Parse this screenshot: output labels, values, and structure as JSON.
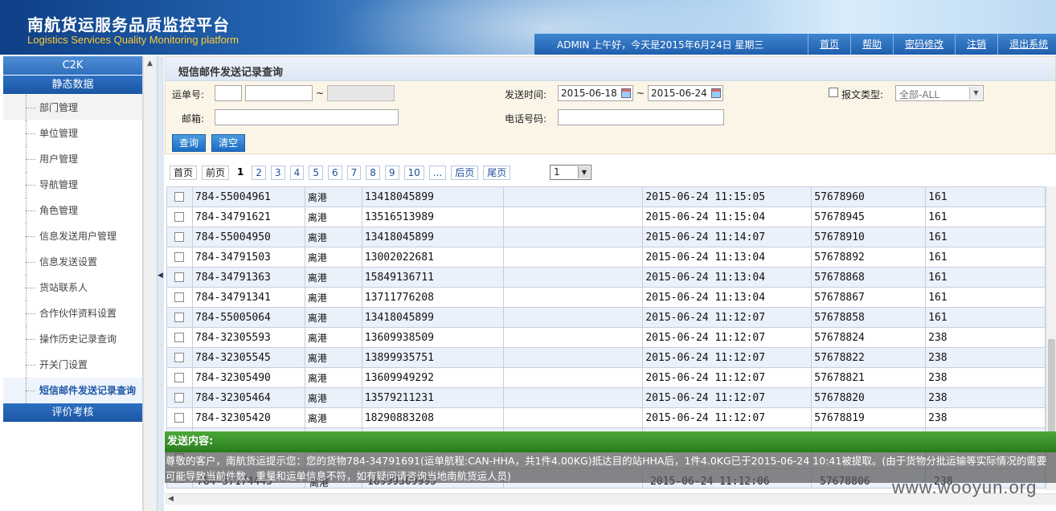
{
  "header": {
    "title_cn": "南航货运服务品质监控平台",
    "title_en": "Logistics Services Quality Monitoring platform",
    "greeting": "ADMIN 上午好，今天是2015年6月24日 星期三",
    "links": [
      "首页",
      "帮助",
      "密码修改",
      "注销",
      "退出系统"
    ]
  },
  "sidebar": {
    "section_c2k": "C2K",
    "section_static": "静态数据",
    "items": [
      "部门管理",
      "单位管理",
      "用户管理",
      "导航管理",
      "角色管理",
      "信息发送用户管理",
      "信息发送设置",
      "货站联系人",
      "合作伙伴资料设置",
      "操作历史记录查询",
      "开关门设置",
      "短信邮件发送记录查询"
    ],
    "section_eval": "评价考核"
  },
  "search": {
    "title": "短信邮件发送记录查询",
    "waybill_label": "运单号:",
    "tilde": "~",
    "send_time_label": "发送时间:",
    "date_from": "2015-06-18",
    "date_to": "2015-06-24",
    "msg_type_label": "报文类型:",
    "msg_type_value": "全部-ALL",
    "email_label": "邮箱:",
    "phone_label": "电话号码:",
    "query_button": "查询",
    "clear_button": "清空"
  },
  "pager": {
    "first": "首页",
    "prev": "前页",
    "current": "1",
    "pages": [
      "2",
      "3",
      "4",
      "5",
      "6",
      "7",
      "8",
      "9",
      "10"
    ],
    "ellipsis": "...",
    "next": "后页",
    "last": "尾页",
    "select_value": "1"
  },
  "table": {
    "rows": [
      {
        "waybill": "784-55004961",
        "type": "离港",
        "phone": "13418045899",
        "email": "",
        "time": "2015-06-24 11:15:05",
        "id": "57678960",
        "code": "161"
      },
      {
        "waybill": "784-34791621",
        "type": "离港",
        "phone": "13516513989",
        "email": "",
        "time": "2015-06-24 11:15:04",
        "id": "57678945",
        "code": "161"
      },
      {
        "waybill": "784-55004950",
        "type": "离港",
        "phone": "13418045899",
        "email": "",
        "time": "2015-06-24 11:14:07",
        "id": "57678910",
        "code": "161"
      },
      {
        "waybill": "784-34791503",
        "type": "离港",
        "phone": "13002022681",
        "email": "",
        "time": "2015-06-24 11:13:04",
        "id": "57678892",
        "code": "161"
      },
      {
        "waybill": "784-34791363",
        "type": "离港",
        "phone": "15849136711",
        "email": "",
        "time": "2015-06-24 11:13:04",
        "id": "57678868",
        "code": "161"
      },
      {
        "waybill": "784-34791341",
        "type": "离港",
        "phone": "13711776208",
        "email": "",
        "time": "2015-06-24 11:13:04",
        "id": "57678867",
        "code": "161"
      },
      {
        "waybill": "784-55005064",
        "type": "离港",
        "phone": "13418045899",
        "email": "",
        "time": "2015-06-24 11:12:07",
        "id": "57678858",
        "code": "161"
      },
      {
        "waybill": "784-32305593",
        "type": "离港",
        "phone": "13609938509",
        "email": "",
        "time": "2015-06-24 11:12:07",
        "id": "57678824",
        "code": "238"
      },
      {
        "waybill": "784-32305545",
        "type": "离港",
        "phone": "13899935751",
        "email": "",
        "time": "2015-06-24 11:12:07",
        "id": "57678822",
        "code": "238"
      },
      {
        "waybill": "784-32305490",
        "type": "离港",
        "phone": "13609949292",
        "email": "",
        "time": "2015-06-24 11:12:07",
        "id": "57678821",
        "code": "238"
      },
      {
        "waybill": "784-32305464",
        "type": "离港",
        "phone": "13579211231",
        "email": "",
        "time": "2015-06-24 11:12:07",
        "id": "57678820",
        "code": "238"
      },
      {
        "waybill": "784-32305420",
        "type": "离港",
        "phone": "18290883208",
        "email": "",
        "time": "2015-06-24 11:12:07",
        "id": "57678819",
        "code": "238"
      },
      {
        "waybill": "",
        "type": "",
        "phone": "",
        "email": "",
        "time": "",
        "id": "",
        "code": ""
      },
      {
        "waybill": "",
        "type": "",
        "phone": "",
        "email": "",
        "time": "",
        "id": "",
        "code": ""
      },
      {
        "waybill": "",
        "type": "",
        "phone": "",
        "email": "",
        "time": "",
        "id": "",
        "code": ""
      }
    ],
    "partial_last": {
      "waybill": "784-57174445",
      "type": "离港",
      "phone": "18999309995",
      "time": "2015-06-24 11:12:06",
      "id": "57678806",
      "code": "238"
    }
  },
  "popup": {
    "title": "发送内容:",
    "content": "尊敬的客户，南航货运提示您：您的货物784-34791691(运单航程:CAN-HHA，共1件4.00KG)抵达目的站HHA后，1件4.0KG已于2015-06-24 10:41被提取。(由于货物分批运输等实际情况的需要可能导致当前件数、重量和运单信息不符，如有疑问请咨询当地南航货运人员)"
  },
  "watermark": "www.wooyun.org"
}
